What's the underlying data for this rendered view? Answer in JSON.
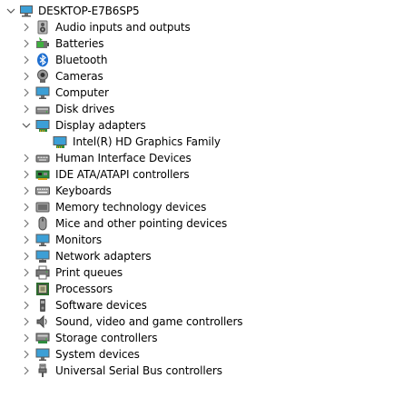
{
  "tree": {
    "root": {
      "label": "DESKTOP-E7B6SP5",
      "icon": "computer-icon",
      "expanded": true
    },
    "categories": [
      {
        "label": "Audio inputs and outputs",
        "icon": "speaker-icon",
        "expanded": false
      },
      {
        "label": "Batteries",
        "icon": "battery-icon",
        "expanded": false
      },
      {
        "label": "Bluetooth",
        "icon": "bluetooth-icon",
        "expanded": false
      },
      {
        "label": "Cameras",
        "icon": "camera-icon",
        "expanded": false
      },
      {
        "label": "Computer",
        "icon": "monitor-icon",
        "expanded": false
      },
      {
        "label": "Disk drives",
        "icon": "disk-drive-icon",
        "expanded": false
      },
      {
        "label": "Display adapters",
        "icon": "display-adapter-icon",
        "expanded": true,
        "children": [
          {
            "label": "Intel(R) HD Graphics Family",
            "icon": "display-adapter-icon"
          }
        ]
      },
      {
        "label": "Human Interface Devices",
        "icon": "hid-icon",
        "expanded": false
      },
      {
        "label": "IDE ATA/ATAPI controllers",
        "icon": "ide-controller-icon",
        "expanded": false
      },
      {
        "label": "Keyboards",
        "icon": "keyboard-icon",
        "expanded": false
      },
      {
        "label": "Memory technology devices",
        "icon": "memory-icon",
        "expanded": false
      },
      {
        "label": "Mice and other pointing devices",
        "icon": "mouse-icon",
        "expanded": false
      },
      {
        "label": "Monitors",
        "icon": "monitor-icon",
        "expanded": false
      },
      {
        "label": "Network adapters",
        "icon": "network-icon",
        "expanded": false
      },
      {
        "label": "Print queues",
        "icon": "printer-icon",
        "expanded": false
      },
      {
        "label": "Processors",
        "icon": "processor-icon",
        "expanded": false
      },
      {
        "label": "Software devices",
        "icon": "software-device-icon",
        "expanded": false
      },
      {
        "label": "Sound, video and game controllers",
        "icon": "speaker-icon",
        "expanded": false
      },
      {
        "label": "Storage controllers",
        "icon": "storage-controller-icon",
        "expanded": false
      },
      {
        "label": "System devices",
        "icon": "system-device-icon",
        "expanded": false
      },
      {
        "label": "Universal Serial Bus controllers",
        "icon": "usb-icon",
        "expanded": false
      }
    ]
  },
  "colors": {
    "chevron": "#7a7a7a",
    "selection_bg": "#cce8ff",
    "monitor_screen": "#3c9fd6",
    "text": "#000000"
  }
}
